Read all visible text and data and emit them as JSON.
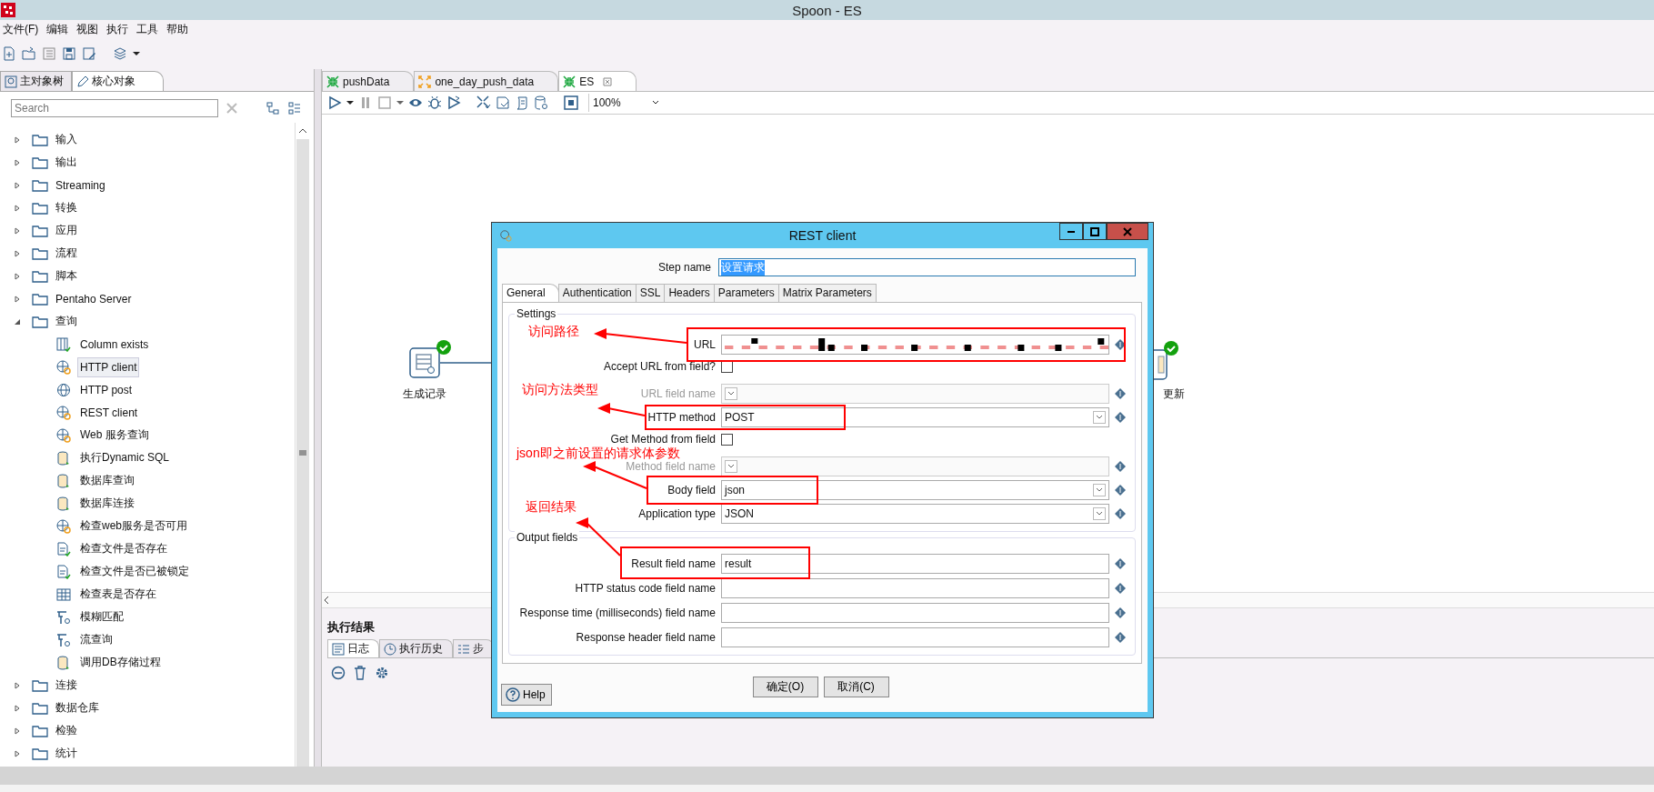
{
  "window": {
    "title": "Spoon - ES"
  },
  "menu": [
    "文件(F)",
    "编辑",
    "视图",
    "执行",
    "工具",
    "帮助"
  ],
  "left_panel": {
    "tabs": [
      {
        "label": "主对象树",
        "selected": false
      },
      {
        "label": "核心对象",
        "selected": true
      }
    ],
    "search": {
      "placeholder": "Search"
    },
    "tree": [
      {
        "label": "输入",
        "expanded": false
      },
      {
        "label": "输出",
        "expanded": false
      },
      {
        "label": "Streaming",
        "expanded": false
      },
      {
        "label": "转换",
        "expanded": false
      },
      {
        "label": "应用",
        "expanded": false
      },
      {
        "label": "流程",
        "expanded": false
      },
      {
        "label": "脚本",
        "expanded": false
      },
      {
        "label": "Pentaho Server",
        "expanded": false
      },
      {
        "label": "查询",
        "expanded": true,
        "children": [
          {
            "label": "Column exists",
            "kind": "column",
            "selected": false
          },
          {
            "label": "HTTP client",
            "kind": "web",
            "selected": true
          },
          {
            "label": "HTTP post",
            "kind": "globe",
            "selected": false
          },
          {
            "label": "REST client",
            "kind": "web",
            "selected": false
          },
          {
            "label": "Web 服务查询",
            "kind": "web",
            "selected": false
          },
          {
            "label": "执行Dynamic SQL",
            "kind": "db",
            "selected": false
          },
          {
            "label": "数据库查询",
            "kind": "db",
            "selected": false
          },
          {
            "label": "数据库连接",
            "kind": "db",
            "selected": false
          },
          {
            "label": "检查web服务是否可用",
            "kind": "web",
            "selected": false
          },
          {
            "label": "检查文件是否存在",
            "kind": "file",
            "selected": false
          },
          {
            "label": "检查文件是否已被锁定",
            "kind": "file",
            "selected": false
          },
          {
            "label": "检查表是否存在",
            "kind": "table",
            "selected": false
          },
          {
            "label": "模糊匹配",
            "kind": "lookup",
            "selected": false
          },
          {
            "label": "流查询",
            "kind": "lookup",
            "selected": false
          },
          {
            "label": "调用DB存储过程",
            "kind": "db",
            "selected": false
          }
        ]
      },
      {
        "label": "连接",
        "expanded": false
      },
      {
        "label": "数据仓库",
        "expanded": false
      },
      {
        "label": "检验",
        "expanded": false
      },
      {
        "label": "统计",
        "expanded": false
      }
    ]
  },
  "editor": {
    "tabs": [
      {
        "label": "pushData",
        "kind": "transformation",
        "selected": false
      },
      {
        "label": "one_day_push_data",
        "kind": "job",
        "selected": false
      },
      {
        "label": "ES",
        "kind": "transformation",
        "selected": true
      }
    ],
    "zoom": "100%",
    "steps": [
      {
        "label": "生成记录"
      },
      {
        "label": "更新"
      }
    ],
    "results": {
      "title": "执行结果",
      "tabs": [
        {
          "label": "日志",
          "selected": true
        },
        {
          "label": "执行历史",
          "selected": false
        },
        {
          "label": "步",
          "selected": false
        }
      ]
    }
  },
  "dialog": {
    "title": "REST client",
    "step_name_label": "Step name",
    "step_name": "设置请求",
    "tabs": [
      {
        "label": "General",
        "selected": true
      },
      {
        "label": "Authentication",
        "selected": false
      },
      {
        "label": "SSL",
        "selected": false
      },
      {
        "label": "Headers",
        "selected": false
      },
      {
        "label": "Parameters",
        "selected": false
      },
      {
        "label": "Matrix Parameters",
        "selected": false
      }
    ],
    "settings": {
      "title": "Settings",
      "rows": [
        {
          "kind": "url",
          "label": "URL"
        },
        {
          "kind": "checkbox",
          "label": "Accept URL from field?",
          "checked": false
        },
        {
          "kind": "combo",
          "label": "URL field name",
          "disabled": true
        },
        {
          "kind": "combo",
          "label": "HTTP method",
          "value": "POST",
          "disabled": false
        },
        {
          "kind": "checkbox",
          "label": "Get Method from field",
          "checked": false
        },
        {
          "kind": "combo",
          "label": "Method field name",
          "disabled": true
        },
        {
          "kind": "combo",
          "label": "Body field",
          "value": "json",
          "disabled": false
        },
        {
          "kind": "combo",
          "label": "Application type",
          "value": "JSON",
          "disabled": false
        }
      ]
    },
    "output": {
      "title": "Output fields",
      "rows": [
        {
          "label": "Result field name",
          "value": "result"
        },
        {
          "label": "HTTP status code field name"
        },
        {
          "label": "Response time (milliseconds) field name"
        },
        {
          "label": "Response header field name"
        }
      ]
    },
    "buttons": [
      "确定(O)",
      "取消(C)"
    ],
    "help": "Help"
  },
  "annotations": [
    {
      "text": "访问路径"
    },
    {
      "text": "访问方法类型"
    },
    {
      "text": "json即之前设置的请求体参数"
    },
    {
      "text": "返回结果"
    }
  ]
}
